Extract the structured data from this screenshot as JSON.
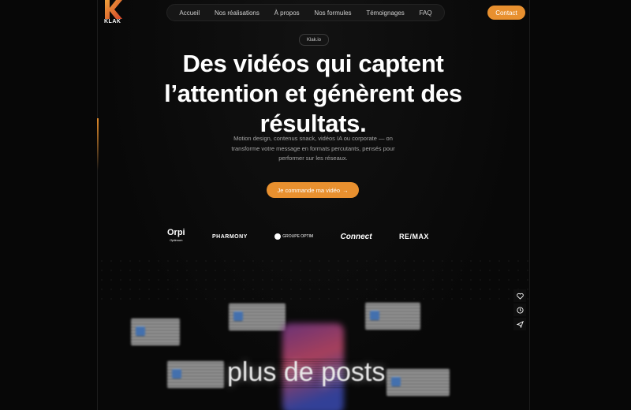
{
  "brand": {
    "name": "KLAK"
  },
  "nav": {
    "items": [
      {
        "label": "Accueil"
      },
      {
        "label": "Nos réalisations"
      },
      {
        "label": "À propos"
      },
      {
        "label": "Nos formules"
      },
      {
        "label": "Témoignages"
      },
      {
        "label": "FAQ"
      }
    ],
    "contact_label": "Contact"
  },
  "hero": {
    "badge": "Klak.io",
    "title": "Des vidéos qui captent l’attention et génèrent des résultats.",
    "subtitle": "Motion design, contenus snack, vidéos IA ou corporate — on transforme votre message en formats percutants, pensés pour performer sur les réseaux.",
    "cta_label": "Je commande ma vidéo",
    "cta_arrow": "→"
  },
  "clients": {
    "orpi": "Orpi",
    "orpi_sub": "Optimum",
    "pharmony": "PHARMONY",
    "groupe": "GROUPE OPTIM",
    "connect": "Connect",
    "remax": "RE/MAX"
  },
  "showcase": {
    "overlay_text": "plus de posts"
  },
  "side_actions": [
    "heart-icon",
    "clock-icon",
    "send-icon"
  ],
  "colors": {
    "accent": "#e8902f",
    "background": "#070707"
  }
}
